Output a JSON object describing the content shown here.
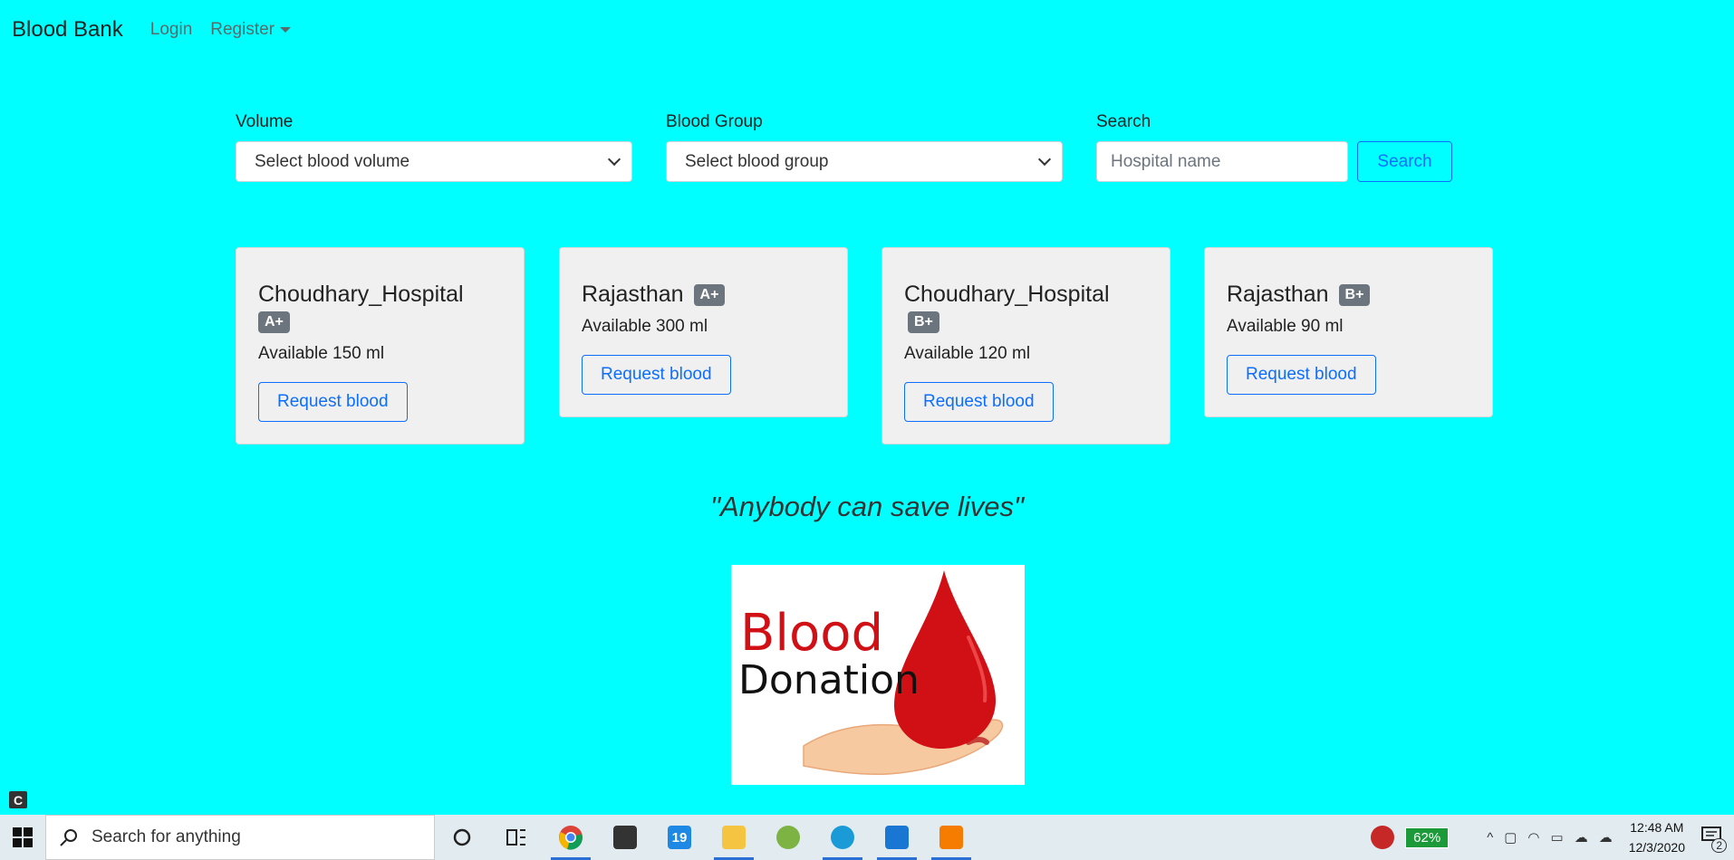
{
  "nav": {
    "brand": "Blood Bank",
    "login": "Login",
    "register": "Register"
  },
  "filters": {
    "volume_label": "Volume",
    "volume_value": "Select blood volume",
    "group_label": "Blood Group",
    "group_value": "Select blood group",
    "search_label": "Search",
    "search_placeholder": "Hospital name",
    "search_button": "Search"
  },
  "cards": [
    {
      "hospital": "Choudhary_Hospital",
      "group": "A+",
      "available": "Available 150 ml",
      "button": "Request blood"
    },
    {
      "hospital": "Rajasthan",
      "group": "A+",
      "available": "Available 300 ml",
      "button": "Request blood"
    },
    {
      "hospital": "Choudhary_Hospital",
      "group": "B+",
      "available": "Available 120 ml",
      "button": "Request blood"
    },
    {
      "hospital": "Rajasthan",
      "group": "B+",
      "available": "Available 90 ml",
      "button": "Request blood"
    }
  ],
  "quote": "\"Anybody can save lives\"",
  "logo": {
    "line1": "Blood",
    "line2": "Donation"
  },
  "taskbar": {
    "search_placeholder": "Search for anything",
    "battery": "62%",
    "time": "12:48 AM",
    "date": "12/3/2020",
    "notif_count": "2"
  },
  "colors": {
    "page_bg": "#00ffff",
    "accent": "#0d6efd",
    "card_bg": "#f0f0f0",
    "badge_bg": "#6c757d",
    "logo_red": "#d01015"
  }
}
